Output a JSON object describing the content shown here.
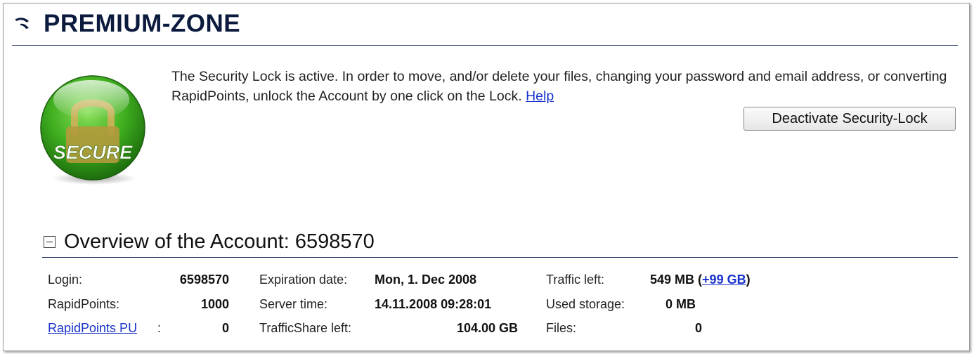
{
  "header": {
    "title": "PREMIUM-ZONE"
  },
  "security": {
    "badge_text": "SECURE",
    "notice_text": "The Security Lock is active. In order to move, and/or delete your files, changing your password and email address, or converting RapidPoints, unlock the Account by one click on the Lock.",
    "help_link": "Help",
    "deactivate_button": "Deactivate Security-Lock"
  },
  "overview": {
    "title": "Overview of the Account: 6598570",
    "login_label": "Login:",
    "login_value": "6598570",
    "rapidpoints_label": "RapidPoints:",
    "rapidpoints_value": "1000",
    "rapidpoints_pu_label": "RapidPoints PU",
    "rapidpoints_pu_colon": ":",
    "rapidpoints_pu_value": "0",
    "expiration_label": "Expiration date:",
    "expiration_value": "Mon, 1. Dec 2008",
    "server_time_label": "Server time:",
    "server_time_value": "14.11.2008 09:28:01",
    "trafficshare_label": "TrafficShare left:",
    "trafficshare_value": "104.00 GB",
    "traffic_left_label": "Traffic left:",
    "traffic_left_value": "549 MB",
    "traffic_left_open": "(",
    "traffic_left_plus": "+99 GB",
    "traffic_left_close": ")",
    "used_storage_label": "Used storage:",
    "used_storage_value": "0 MB",
    "files_label": "Files:",
    "files_value": "0"
  },
  "colors": {
    "title": "#0b1a3d",
    "rule": "#2a3e6b",
    "link": "#1a33cc",
    "badge_green": "#3fae1f"
  }
}
